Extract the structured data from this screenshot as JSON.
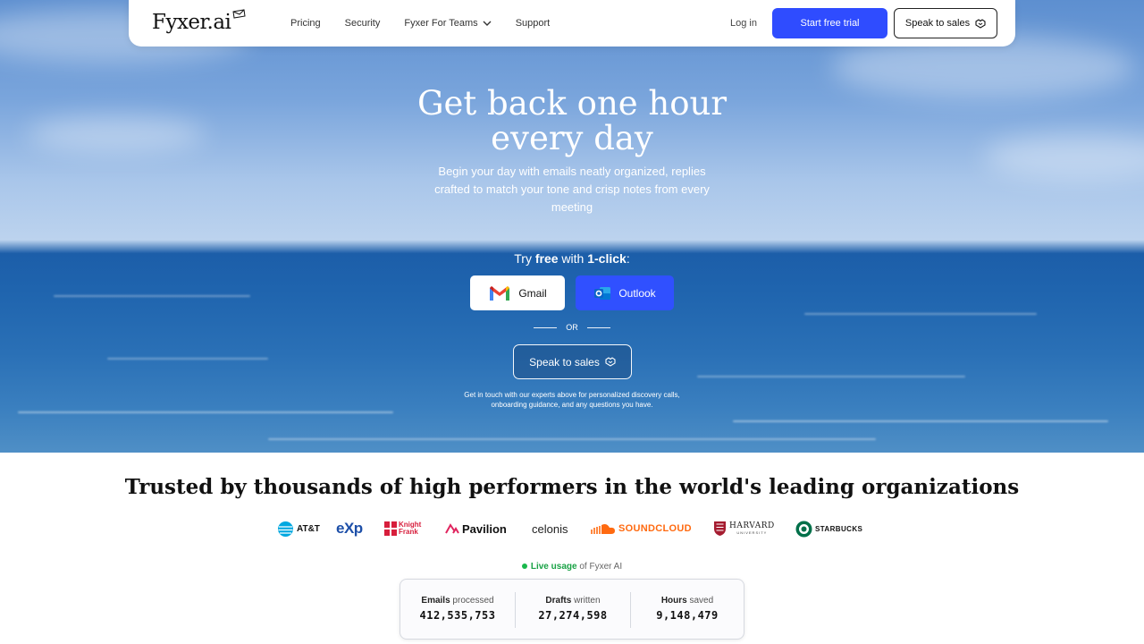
{
  "nav": {
    "logo": "Fyxer.ai",
    "links": [
      "Pricing",
      "Security",
      "Fyxer For Teams",
      "Support"
    ],
    "login": "Log in",
    "trial_button": "Start free trial",
    "sales_button": "Speak to sales"
  },
  "hero": {
    "title_line1": "Get back one hour",
    "title_line2": "every day",
    "subtitle": "Begin your day with emails neatly organized, replies crafted to match your tone and crisp notes from every meeting",
    "try_prefix": "Try ",
    "try_free": "free",
    "try_with": " with ",
    "try_click": "1-click",
    "try_suffix": ":",
    "gmail_button": "Gmail",
    "outlook_button": "Outlook",
    "or": "OR",
    "sales_button": "Speak to sales",
    "note_line1": "Get in touch with our experts above for personalized discovery calls,",
    "note_line2": "onboarding guidance, and any questions you have."
  },
  "trust": {
    "title": "Trusted by thousands of high performers in the world's leading organizations",
    "logos": [
      "AT&T",
      "eXp",
      "Knight Frank",
      "Pavilion",
      "celonis",
      "SOUNDCLOUD",
      "HARVARD",
      "STARBUCKS"
    ],
    "harvard_sub": "UNIVERSITY"
  },
  "live": {
    "label": "Live usage",
    "suffix": " of Fyxer AI"
  },
  "stats": [
    {
      "label_bold": "Emails",
      "label_rest": " processed",
      "value": "412,535,753"
    },
    {
      "label_bold": "Drafts",
      "label_rest": " written",
      "value": "27,274,598"
    },
    {
      "label_bold": "Hours",
      "label_rest": " saved",
      "value": "9,148,479"
    }
  ],
  "colors": {
    "primary": "#2f4cff",
    "outlook": "#3050ff",
    "live_green": "#19a245",
    "soundcloud": "#ff6a10",
    "knight_frank": "#d71e3c"
  }
}
